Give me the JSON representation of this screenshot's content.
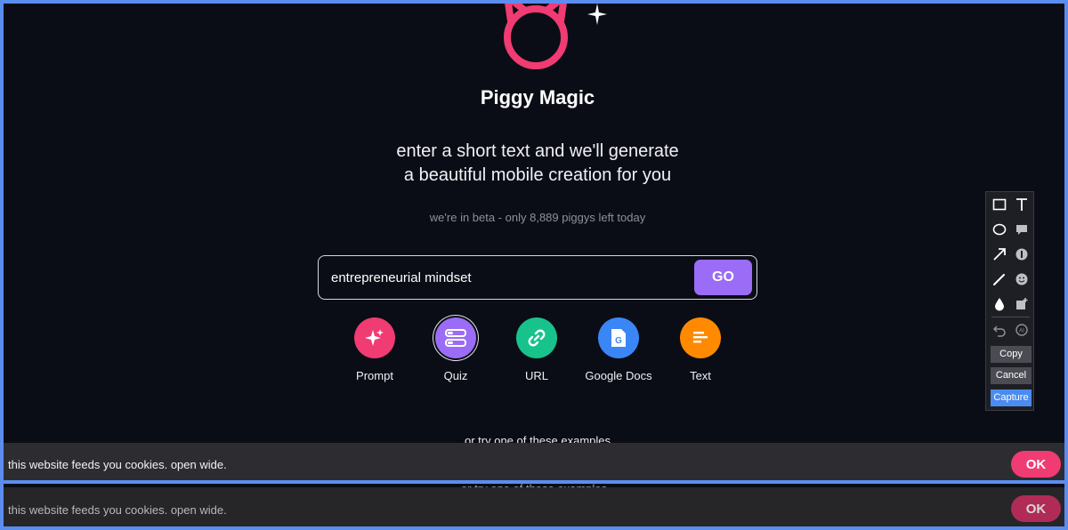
{
  "app": {
    "title": "Piggy Magic",
    "subtitle_line1": "enter a short text and we'll generate",
    "subtitle_line2": "a beautiful mobile creation for you",
    "beta_notice": "we're in beta - only 8,889 piggys left today"
  },
  "search": {
    "value": "entrepreneurial mindset",
    "go_label": "GO"
  },
  "modes": [
    {
      "label": "Prompt",
      "color": "#f03b73",
      "icon": "sparkles-icon"
    },
    {
      "label": "Quiz",
      "color": "#9b6cf5",
      "icon": "quiz-icon",
      "selected": true
    },
    {
      "label": "URL",
      "color": "#17c38b",
      "icon": "link-icon"
    },
    {
      "label": "Google Docs",
      "color": "#3b86f6",
      "icon": "google-docs-icon"
    },
    {
      "label": "Text",
      "color": "#ff8a00",
      "icon": "text-lines-icon"
    }
  ],
  "examples_text": "or try one of these examples",
  "cookie": {
    "message": "this website feeds you cookies. open wide.",
    "ok_label": "OK"
  },
  "toolbar": {
    "copy_label": "Copy",
    "cancel_label": "Cancel",
    "capture_label": "Capture"
  },
  "colors": {
    "background": "#0b0d16",
    "accent_pink": "#f03b73",
    "accent_purple": "#9b6cf5",
    "frame_blue": "#5b8def"
  }
}
